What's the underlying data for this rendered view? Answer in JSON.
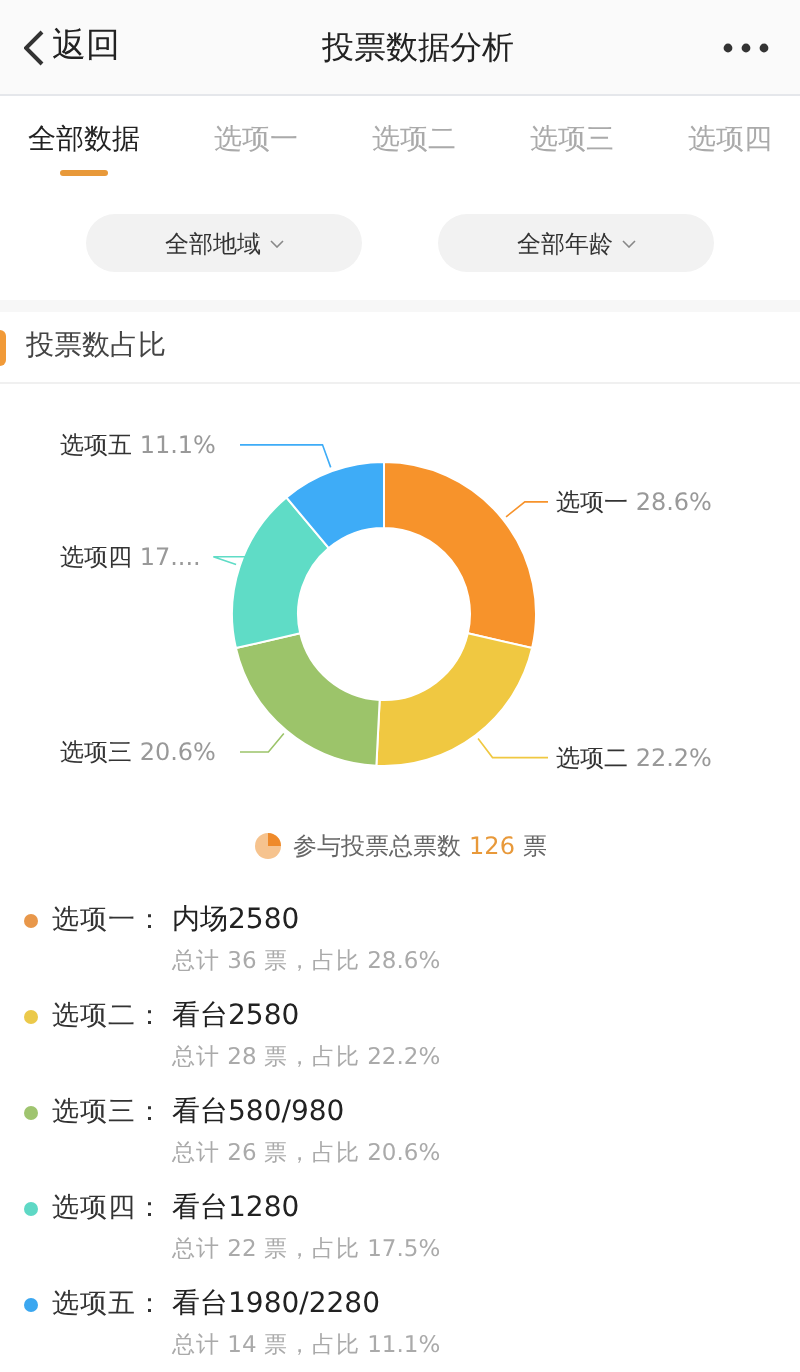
{
  "nav": {
    "back": "返回",
    "title": "投票数据分析"
  },
  "tabs": [
    {
      "label": "全部数据",
      "selected": true
    },
    {
      "label": "选项一",
      "selected": false
    },
    {
      "label": "选项二",
      "selected": false
    },
    {
      "label": "选项三",
      "selected": false
    },
    {
      "label": "选项四",
      "selected": false
    }
  ],
  "filters": [
    "全部地域",
    "全部年龄"
  ],
  "section_title": "投票数占比",
  "chart_data": {
    "type": "donut",
    "categories": [
      "选项一",
      "选项二",
      "选项三",
      "选项四",
      "选项五"
    ],
    "values": [
      28.6,
      22.2,
      20.6,
      17.5,
      11.1
    ],
    "value_labels": [
      "28.6%",
      "22.2%",
      "20.6%",
      "17....",
      "11.1%"
    ],
    "data_labels": true
  },
  "total": {
    "label": "参与投票总票数",
    "count": "126",
    "unit": "票"
  },
  "options": [
    {
      "label": "选项一：",
      "name": "内场2580",
      "detail": "总计 36 票，占比 28.6%",
      "color": "#e8974a"
    },
    {
      "label": "选项二：",
      "name": "看台2580",
      "detail": "总计 28 票，占比 22.2%",
      "color": "#ebc94a"
    },
    {
      "label": "选项三：",
      "name": "看台580/980",
      "detail": "总计 26 票，占比 20.6%",
      "color": "#9fc46f"
    },
    {
      "label": "选项四：",
      "name": "看台1280",
      "detail": "总计 22 票，占比 17.5%",
      "color": "#5ed8c5"
    },
    {
      "label": "选项五：",
      "name": "看台1980/2280",
      "detail": "总计 14 票，占比 11.1%",
      "color": "#3ba7f0"
    }
  ]
}
